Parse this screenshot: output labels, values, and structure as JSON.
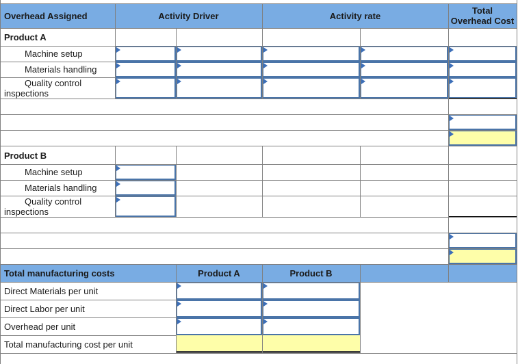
{
  "overhead_table": {
    "headers": {
      "overhead_assigned": "Overhead Assigned",
      "activity_driver": "Activity Driver",
      "activity_rate": "Activity rate",
      "total_overhead_cost_line1": "Total",
      "total_overhead_cost_line2": "Overhead Cost"
    },
    "product_a": {
      "label": "Product A",
      "rows": [
        {
          "label": "Machine setup",
          "driver_1": "",
          "driver_2": "",
          "rate_1": "",
          "rate_2": "",
          "total": ""
        },
        {
          "label": "Materials handling",
          "driver_1": "",
          "driver_2": "",
          "rate_1": "",
          "rate_2": "",
          "total": ""
        },
        {
          "label_line1": "Quality control",
          "label_line2": "inspections",
          "driver_1": "",
          "driver_2": "",
          "rate_1": "",
          "rate_2": "",
          "total": ""
        }
      ],
      "subtotal": "",
      "grand_total": ""
    },
    "product_b": {
      "label": "Product B",
      "rows": [
        {
          "label": "Machine setup",
          "driver_1": ""
        },
        {
          "label": "Materials handling",
          "driver_1": ""
        },
        {
          "label_line1": "Quality control",
          "label_line2": "inspections",
          "driver_1": ""
        }
      ],
      "subtotal": "",
      "grand_total": ""
    }
  },
  "manufacturing_table": {
    "header": "Total manufacturing costs",
    "col_product_a": "Product A",
    "col_product_b": "Product B",
    "rows": [
      {
        "label": "Direct Materials per unit",
        "product_a": "",
        "product_b": ""
      },
      {
        "label": "Direct Labor per unit",
        "product_a": "",
        "product_b": ""
      },
      {
        "label": "Overhead per unit",
        "product_a": "",
        "product_b": ""
      },
      {
        "label": "Total manufacturing cost per unit",
        "product_a": "",
        "product_b": ""
      }
    ]
  },
  "colors": {
    "header_bg": "#79ace3",
    "input_border": "#4a74a8",
    "total_fill": "#fefea9"
  }
}
